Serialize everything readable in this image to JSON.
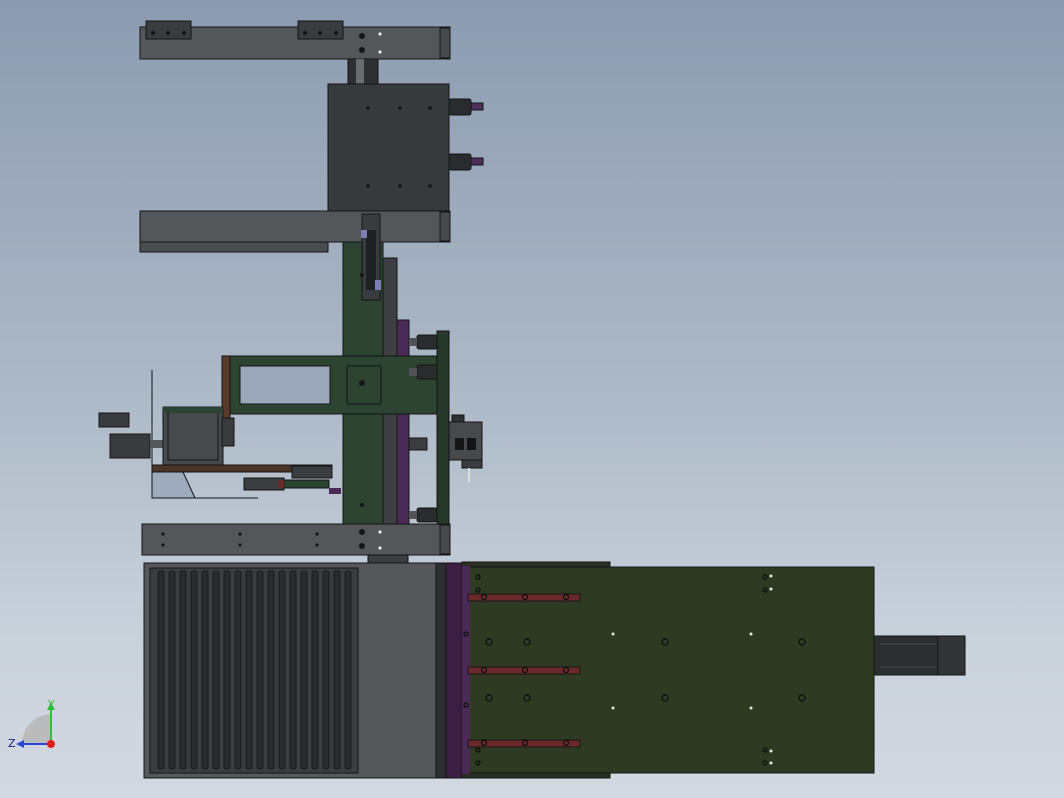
{
  "view": {
    "background_top": "#8c9bb0",
    "background_bottom": "#d3d9e1"
  },
  "colors": {
    "dark_steel": "#3c3d40",
    "plate_gray": "#54565a",
    "green_plate": "#2c4431",
    "olive_plate": "#2f3a22",
    "purple_rail": "#4a2a57",
    "brown_strip": "#6a2a2c",
    "motor_black": "#2d2e30",
    "edge_line": "#151515"
  },
  "triad": {
    "x_label": "",
    "y_label": "Y",
    "z_label": "Z",
    "y_color": "#2fbf3a",
    "x_color": "#e02020",
    "z_color": "#2a48d8"
  }
}
